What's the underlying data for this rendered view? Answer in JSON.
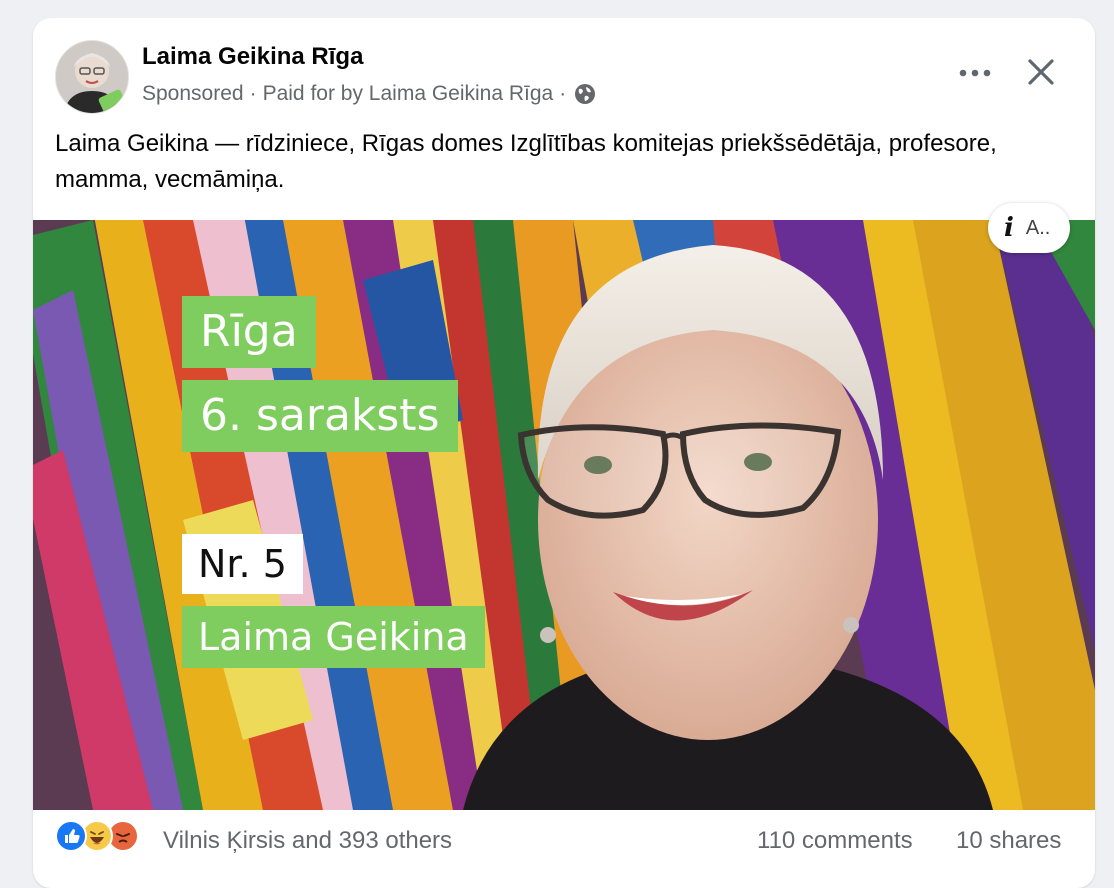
{
  "post": {
    "page_name": "Laima Geikina Rīga",
    "sponsored_label": "Sponsored",
    "separator": "·",
    "paid_for": "Paid for by Laima Geikina Rīga",
    "body_text": "Laima Geikina — rīdziniece, Rīgas domes Izglītības komitejas priekšsēdētāja, profesore, mamma, vecmāmiņa."
  },
  "image": {
    "ad_info_label": "A..",
    "overlay": {
      "city": "Rīga",
      "list": "6. saraksts",
      "number": "Nr. 5",
      "candidate": "Laima Geikina"
    }
  },
  "footer": {
    "reactions_text": "Vilnis Ķirsis and 393 others",
    "comments": "110 comments",
    "shares": "10 shares"
  },
  "icons": {
    "more": "more-horizontal-icon",
    "close": "close-icon",
    "audience": "globe-icon",
    "info": "info-icon",
    "reactions": [
      "like-icon",
      "haha-icon",
      "angry-icon"
    ]
  },
  "colors": {
    "overlay_green": "#7fcc5f",
    "secondary_text": "#65676b",
    "like_blue": "#1877f2"
  }
}
